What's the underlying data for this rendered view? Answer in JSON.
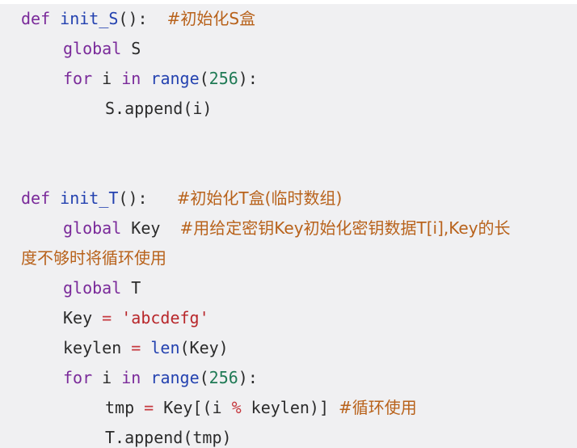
{
  "lines": {
    "l1": {
      "kw": "def",
      "fn": "init_S",
      "p": "():",
      "cm": "#初始化S盒"
    },
    "l2": {
      "kw": "global",
      "v": "S"
    },
    "l3": {
      "kw": "for",
      "v": "i",
      "kw2": "in",
      "fn": "range",
      "p1": "(",
      "num": "256",
      "p2": "):"
    },
    "l4": {
      "v": "S.append(i)"
    },
    "l5": {
      "kw": "def",
      "fn": "init_T",
      "p": "():",
      "cm": "#初始化T盒(临时数组)"
    },
    "l6": {
      "kw": "global",
      "v": "Key",
      "cm": "#用给定密钥Key初始化密钥数据T[i],Key的长"
    },
    "l6b": {
      "cm": "度不够时将循环使用"
    },
    "l7": {
      "kw": "global",
      "v": "T"
    },
    "l8": {
      "v": "Key",
      "op": "=",
      "str": "'abcdefg'"
    },
    "l9": {
      "v": "keylen",
      "op": "=",
      "fn": "len",
      "arg": "(Key)"
    },
    "l10": {
      "kw": "for",
      "v": "i",
      "kw2": "in",
      "fn": "range",
      "p1": "(",
      "num": "256",
      "p2": "):"
    },
    "l11": {
      "v": "tmp",
      "op": "=",
      "a": "Key[(i",
      "op2": "%",
      "b": "keylen)]",
      "cm": "#循环使用"
    },
    "l12": {
      "v": "T.append(tmp)"
    }
  },
  "colors": {
    "background": "#f0f0f2",
    "keyword": "#7a2a9a",
    "function": "#2442b0",
    "number": "#1f7a55",
    "string": "#b8272b",
    "operator": "#c6393f",
    "comment": "#b8621b"
  }
}
